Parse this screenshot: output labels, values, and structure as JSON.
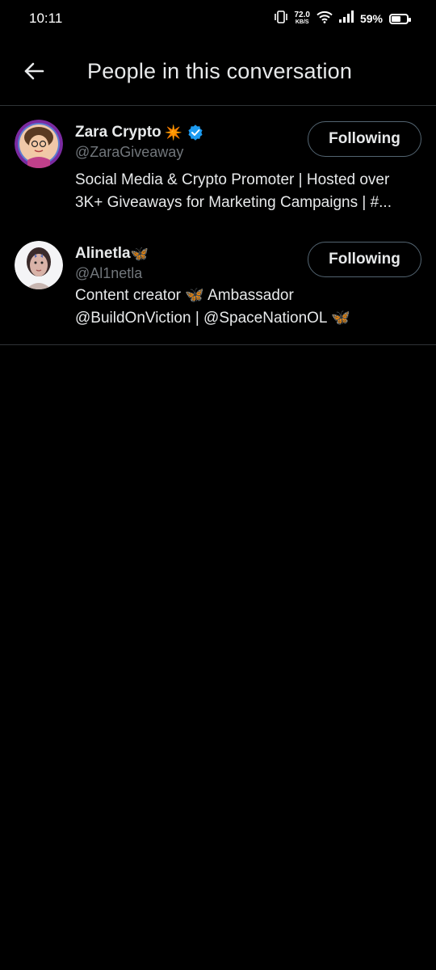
{
  "status_bar": {
    "time": "10:11",
    "net_speed_value": "72.0",
    "net_speed_unit": "KB/S",
    "battery_percent_text": "59%",
    "battery_level": 0.59,
    "icons": [
      "vibrate-icon",
      "wifi-icon",
      "signal-icon",
      "battery-icon"
    ]
  },
  "header": {
    "title": "People in this conversation",
    "back_icon": "arrow-left-icon"
  },
  "people": [
    {
      "name": "Zara Crypto",
      "name_emoji": "✴️",
      "verified": true,
      "handle": "@ZaraGiveaway",
      "bio_lines": [
        "Social Media & Crypto Promoter | Hosted over",
        "3K+ Giveaways for Marketing Campaigns | #..."
      ],
      "follow_label": "Following"
    },
    {
      "name": "Alinetla",
      "name_emoji": "🦋",
      "verified": false,
      "handle": "@Al1netla",
      "bio_lines": [
        "Content creator 🦋 Ambassador",
        "@BuildOnViction | @SpaceNationOL 🦋"
      ],
      "follow_label": "Following"
    }
  ],
  "colors": {
    "background": "#000000",
    "text_primary": "#e7e9ea",
    "text_secondary": "#71767b",
    "divider": "#2f3336",
    "verified_blue": "#1d9bf0",
    "button_border": "#536471"
  }
}
